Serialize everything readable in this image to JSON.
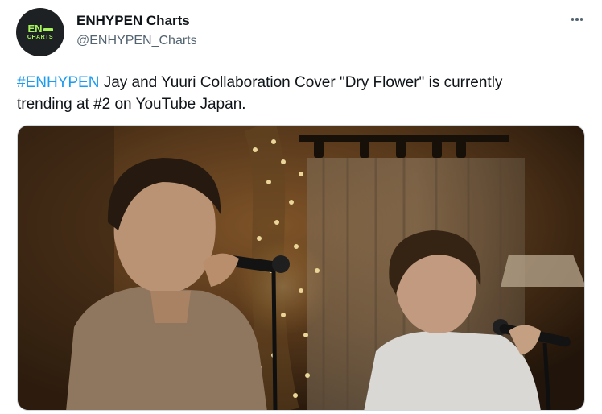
{
  "account": {
    "display_name": "ENHYPEN Charts",
    "handle": "@ENHYPEN_Charts",
    "avatar_logo_top": "EN",
    "avatar_logo_bottom": "CHARTS"
  },
  "tweet": {
    "hashtag": "#ENHYPEN",
    "text_line1": " Jay and Yuuri Collaboration Cover \"Dry Flower\" is currently",
    "text_line2": "trending at #2 on YouTube Japan."
  },
  "icons": {
    "more": "more-horizontal-icon"
  },
  "colors": {
    "hashtag": "#1d9bf0",
    "text": "#0f1419",
    "secondary_text": "#536471",
    "avatar_accent": "#a6f35a"
  }
}
